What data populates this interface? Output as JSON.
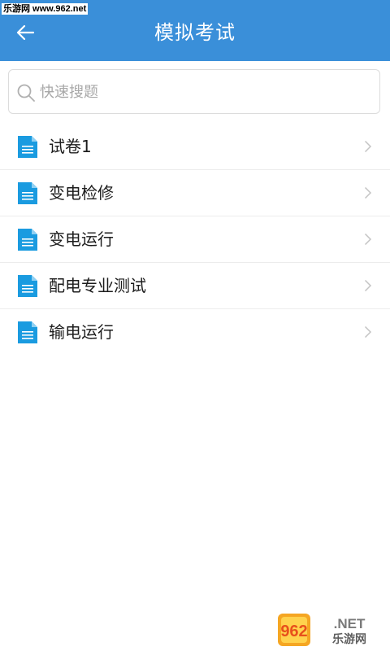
{
  "watermark_top": "乐游网 www.962.net",
  "header": {
    "back_icon": "arrow-left-icon",
    "title": "模拟考试",
    "background": "#3a8fd9"
  },
  "search": {
    "icon": "search-icon",
    "placeholder": "快速搜题",
    "value": ""
  },
  "exams": [
    {
      "label": "试卷1",
      "icon": "document-icon"
    },
    {
      "label": "变电检修",
      "icon": "document-icon"
    },
    {
      "label": "变电运行",
      "icon": "document-icon"
    },
    {
      "label": "配电专业测试",
      "icon": "document-icon"
    },
    {
      "label": "输电运行",
      "icon": "document-icon"
    }
  ],
  "logo": {
    "main": "962",
    "suffix": ".NET",
    "sub": "乐游网"
  },
  "colors": {
    "accent": "#3a8fd9",
    "doc_icon": "#1a9be0"
  }
}
